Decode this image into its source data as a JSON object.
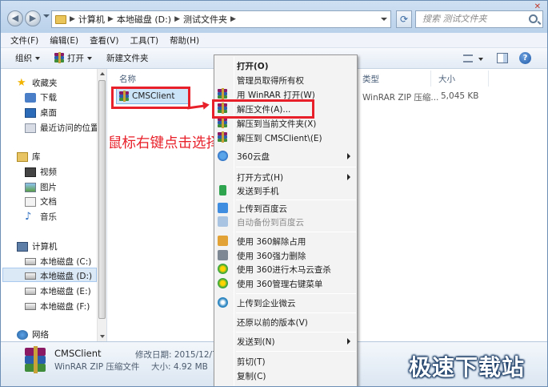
{
  "address": {
    "crumbs": [
      "计算机",
      "本地磁盘 (D:)",
      "测试文件夹"
    ],
    "search_placeholder": "搜索 测试文件夹"
  },
  "menubar": [
    "文件(F)",
    "编辑(E)",
    "查看(V)",
    "工具(T)",
    "帮助(H)"
  ],
  "toolbar": {
    "organize": "组织",
    "open": "打开",
    "new_folder": "新建文件夹"
  },
  "nav": {
    "favorites": "收藏夹",
    "downloads": "下载",
    "desktop": "桌面",
    "recent": "最近访问的位置",
    "libraries": "库",
    "videos": "视频",
    "pictures": "图片",
    "documents": "文档",
    "music": "音乐",
    "computer": "计算机",
    "drive_c": "本地磁盘 (C:)",
    "drive_d": "本地磁盘 (D:)",
    "drive_e": "本地磁盘 (E:)",
    "drive_f": "本地磁盘 (F:)",
    "network": "网络"
  },
  "columns": {
    "name": "名称",
    "type": "类型",
    "size": "大小"
  },
  "file": {
    "name": "CMSClient",
    "type": "WinRAR ZIP 压缩...",
    "size": "5,045 KB"
  },
  "details": {
    "name": "CMSClient",
    "type": "WinRAR ZIP 压缩文件",
    "modified_label": "修改日期: 2015/12/7 1",
    "size_label": "大小: 4.92 MB"
  },
  "context_menu": {
    "open": "打开(O)",
    "take_ownership": "管理员取得所有权",
    "open_winrar": "用 WinRAR 打开(W)",
    "extract_files": "解压文件(A)...",
    "extract_here": "解压到当前文件夹(X)",
    "extract_to": "解压到 CMSClient\\(E)",
    "cloud360": "360云盘",
    "open_with": "打开方式(H)",
    "send_phone": "发送到手机",
    "upload_baidu": "上传到百度云",
    "auto_backup": "自动备份到百度云",
    "unlock360": "使用 360解除占用",
    "shred360": "使用 360强力删除",
    "scan360": "使用 360进行木马云查杀",
    "manage360": "使用 360管理右键菜单",
    "upload_ent": "上传到企业微云",
    "restore": "还原以前的版本(V)",
    "send_to": "发送到(N)",
    "cut": "剪切(T)",
    "copy": "复制(C)"
  },
  "annotation": "鼠标右键点击选择解压文件",
  "watermark": "极速下载站",
  "colors": {
    "annotation": "#e8202a",
    "selection": "#cce4f7",
    "menu_bg": "#f3f3f3"
  }
}
